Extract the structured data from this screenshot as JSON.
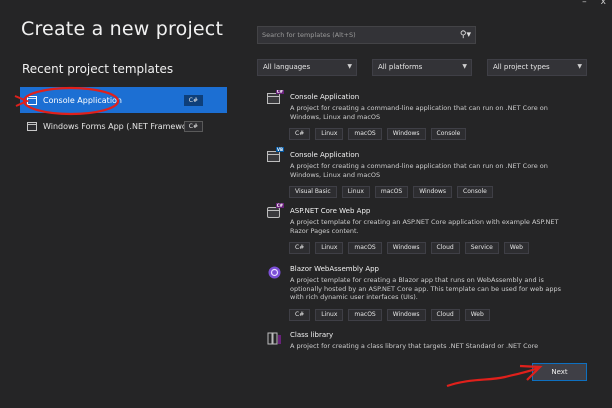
{
  "window": {
    "minimize": "–",
    "close": "x"
  },
  "title": "Create a new project",
  "recent": {
    "heading": "Recent project templates",
    "items": [
      {
        "label": "Console Application",
        "lang": "C#",
        "selected": true
      },
      {
        "label": "Windows Forms App (.NET Framework)",
        "lang": "C#",
        "selected": false
      }
    ]
  },
  "search": {
    "placeholder": "Search for templates (Alt+S)",
    "icon": "search-icon"
  },
  "filters": {
    "languages": "All languages",
    "platforms": "All platforms",
    "types": "All project types"
  },
  "templates": [
    {
      "name": "Console Application",
      "badge": "C#",
      "description": "A project for creating a command-line application that can run on .NET Core on Windows, Linux and macOS",
      "tags": [
        "C#",
        "Linux",
        "macOS",
        "Windows",
        "Console"
      ]
    },
    {
      "name": "Console Application",
      "badge": "VB",
      "description": "A project for creating a command-line application that can run on .NET Core on Windows, Linux and macOS",
      "tags": [
        "Visual Basic",
        "Linux",
        "macOS",
        "Windows",
        "Console"
      ]
    },
    {
      "name": "ASP.NET Core Web App",
      "badge": "C#",
      "description": "A project template for creating an ASP.NET Core application with example ASP.NET Razor Pages content.",
      "tags": [
        "C#",
        "Linux",
        "macOS",
        "Windows",
        "Cloud",
        "Service",
        "Web"
      ]
    },
    {
      "name": "Blazor WebAssembly App",
      "badge": "",
      "description": "A project template for creating a Blazor app that runs on WebAssembly and is optionally hosted by an ASP.NET Core app. This template can be used for web apps with rich dynamic user interfaces (UIs).",
      "tags": [
        "C#",
        "Linux",
        "macOS",
        "Windows",
        "Cloud",
        "Web"
      ]
    },
    {
      "name": "Class library",
      "badge": "",
      "description": "A project for creating a class library that targets .NET Standard or .NET Core",
      "tags": []
    }
  ],
  "next_button": "Next",
  "colors": {
    "background": "#252526",
    "selected": "#1c6fd3",
    "annotation": "#e0201b"
  }
}
